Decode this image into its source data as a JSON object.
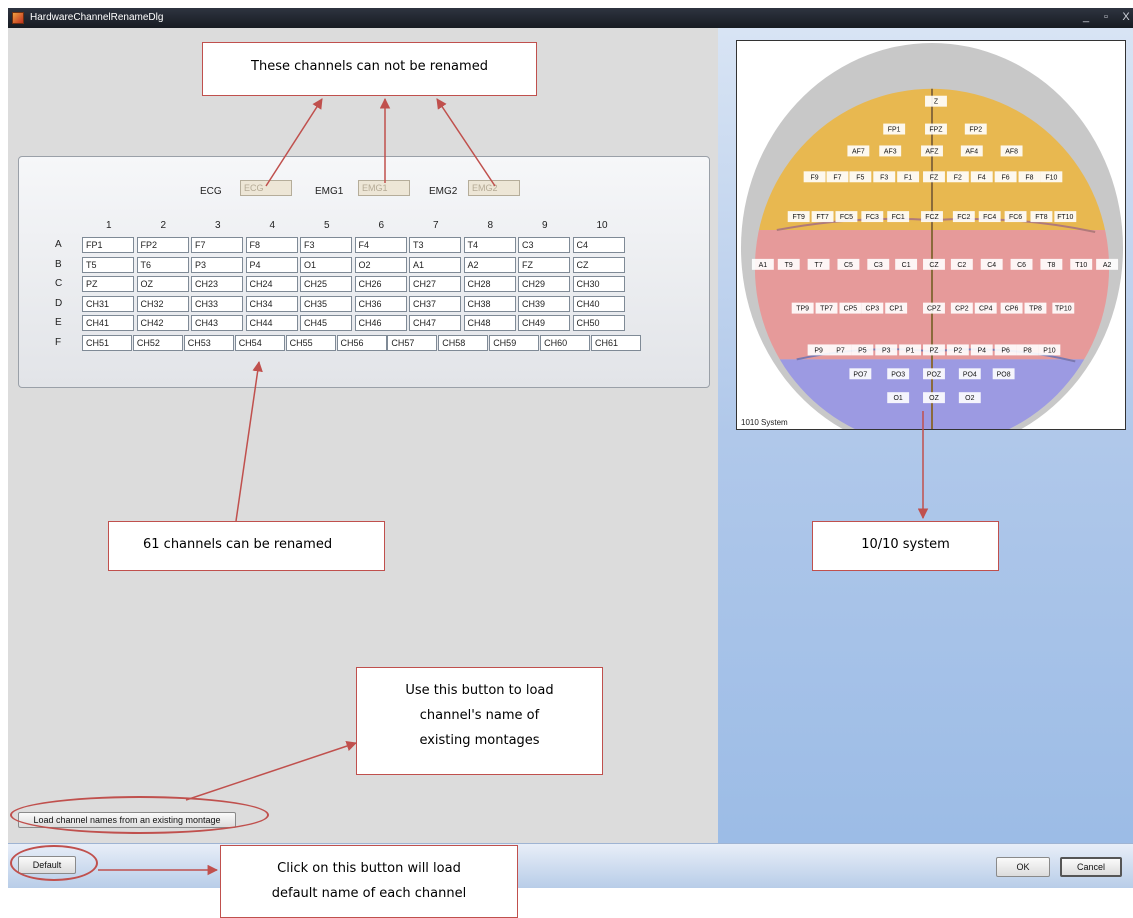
{
  "window": {
    "title": "HardwareChannelRenameDlg",
    "minimize_glyph": "_",
    "maximize_glyph": "▫",
    "close_glyph": "X"
  },
  "fixed_channels": [
    {
      "label": "ECG",
      "value": "ECG"
    },
    {
      "label": "EMG1",
      "value": "EMG1"
    },
    {
      "label": "EMG2",
      "value": "EMG2"
    }
  ],
  "grid": {
    "columns": [
      "1",
      "2",
      "3",
      "4",
      "5",
      "6",
      "7",
      "8",
      "9",
      "10"
    ],
    "rows": [
      {
        "label": "A",
        "values": [
          "FP1",
          "FP2",
          "F7",
          "F8",
          "F3",
          "F4",
          "T3",
          "T4",
          "C3",
          "C4"
        ]
      },
      {
        "label": "B",
        "values": [
          "T5",
          "T6",
          "P3",
          "P4",
          "O1",
          "O2",
          "A1",
          "A2",
          "FZ",
          "CZ"
        ]
      },
      {
        "label": "C",
        "values": [
          "PZ",
          "OZ",
          "CH23",
          "CH24",
          "CH25",
          "CH26",
          "CH27",
          "CH28",
          "CH29",
          "CH30"
        ]
      },
      {
        "label": "D",
        "values": [
          "CH31",
          "CH32",
          "CH33",
          "CH34",
          "CH35",
          "CH36",
          "CH37",
          "CH38",
          "CH39",
          "CH40"
        ]
      },
      {
        "label": "E",
        "values": [
          "CH41",
          "CH42",
          "CH43",
          "CH44",
          "CH45",
          "CH46",
          "CH47",
          "CH48",
          "CH49",
          "CH50"
        ]
      },
      {
        "label": "F",
        "values": [
          "CH51",
          "CH52",
          "CH53",
          "CH54",
          "CH55",
          "CH56",
          "CH57",
          "CH58",
          "CH59",
          "CH60",
          "CH61"
        ]
      }
    ]
  },
  "buttons": {
    "load_montage": "Load channel names from an existing montage",
    "default": "Default",
    "ok": "OK",
    "cancel": "Cancel"
  },
  "electrode_map": {
    "caption": "1010 System",
    "colors": {
      "frontal": "#e8b850",
      "central": "#e69a9a",
      "occipital": "#9c9ae2",
      "head": "#c8c8c8"
    },
    "electrodes": [
      "Z",
      "FP1",
      "FPZ",
      "FP2",
      "AF7",
      "AF3",
      "AFZ",
      "AF4",
      "AF8",
      "F9",
      "F7",
      "F5",
      "F3",
      "F1",
      "FZ",
      "F2",
      "F4",
      "F6",
      "F8",
      "F10",
      "FT9",
      "FT7",
      "FC5",
      "FC3",
      "FC1",
      "FCZ",
      "FC2",
      "FC4",
      "FC6",
      "FT8",
      "FT10",
      "A1",
      "T9",
      "T7",
      "C5",
      "C3",
      "C1",
      "CZ",
      "C2",
      "C4",
      "C6",
      "T8",
      "T10",
      "A2",
      "TP9",
      "TP7",
      "CP5",
      "CP3",
      "CP1",
      "CPZ",
      "CP2",
      "CP4",
      "CP6",
      "TP8",
      "TP10",
      "P9",
      "P7",
      "P5",
      "P3",
      "P1",
      "PZ",
      "P2",
      "P4",
      "P6",
      "P8",
      "P10",
      "PO7",
      "PO3",
      "POZ",
      "PO4",
      "PO8",
      "O1",
      "OZ",
      "O2"
    ]
  },
  "annotations": {
    "not_renamed": "These channels can not be renamed",
    "can_rename": "61 channels can be renamed",
    "system": "10/10 system",
    "load_help_lines": [
      "Use this button to load",
      "channel's name of",
      "existing montages"
    ],
    "default_help_lines": [
      "Click on this button will load",
      "default name of each channel"
    ],
    "color": "#c0504d"
  }
}
